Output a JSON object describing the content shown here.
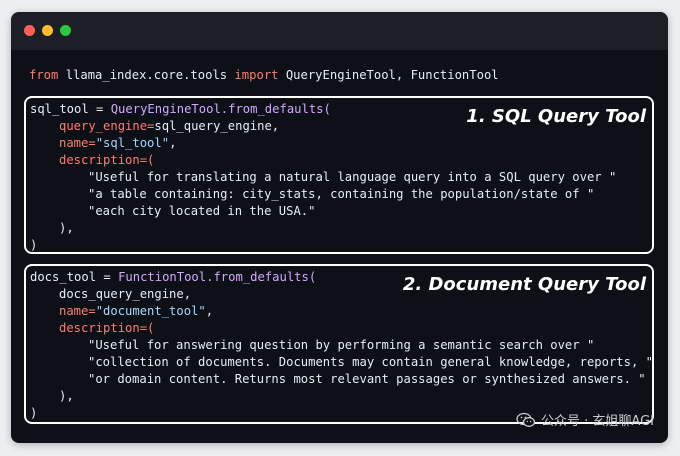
{
  "window": {
    "buttons": [
      "close",
      "minimize",
      "maximize"
    ]
  },
  "import_line": {
    "kw_from": "from",
    "module": " llama_index.core.tools ",
    "kw_import": "import",
    "names": " QueryEngineTool, FunctionTool"
  },
  "sql_box": {
    "label": "1. SQL Query Tool",
    "l1_a": "sql_tool = ",
    "l1_b": "QueryEngineTool.from_defaults(",
    "l2_param": "query_engine=",
    "l2_val": "sql_query_engine,",
    "l3_param": "name=",
    "l3_val": "\"sql_tool\"",
    "l3_end": ",",
    "l4_param": "description=(",
    "l5": "\"Useful for translating a natural language query into a SQL query over \"",
    "l6": "\"a table containing: city_stats, containing the population/state of \"",
    "l7": "\"each city located in the USA.\"",
    "l8": "),",
    "l9": ")"
  },
  "docs_box": {
    "label": "2. Document Query Tool",
    "l1_a": "docs_tool = ",
    "l1_b": "FunctionTool.from_defaults(",
    "l2": "docs_query_engine,",
    "l3_param": "name=",
    "l3_val": "\"document_tool\"",
    "l3_end": ",",
    "l4_param": "description=(",
    "l5": "\"Useful for answering question by performing a semantic search over \"",
    "l6": "\"collection of documents. Documents may contain general knowledge, reports, \"",
    "l7": "\"or domain content. Returns most relevant passages or synthesized answers. \"",
    "l8": "),",
    "l9": ")"
  },
  "watermark": {
    "text": "公众号 · 玄姐聊AGI",
    "icon": "wechat-icon"
  },
  "colors": {
    "keyword": "#ff7b72",
    "function": "#d2a8ff",
    "string": "#a5d6ff",
    "text": "#e6edf3",
    "background": "#0d1117"
  }
}
